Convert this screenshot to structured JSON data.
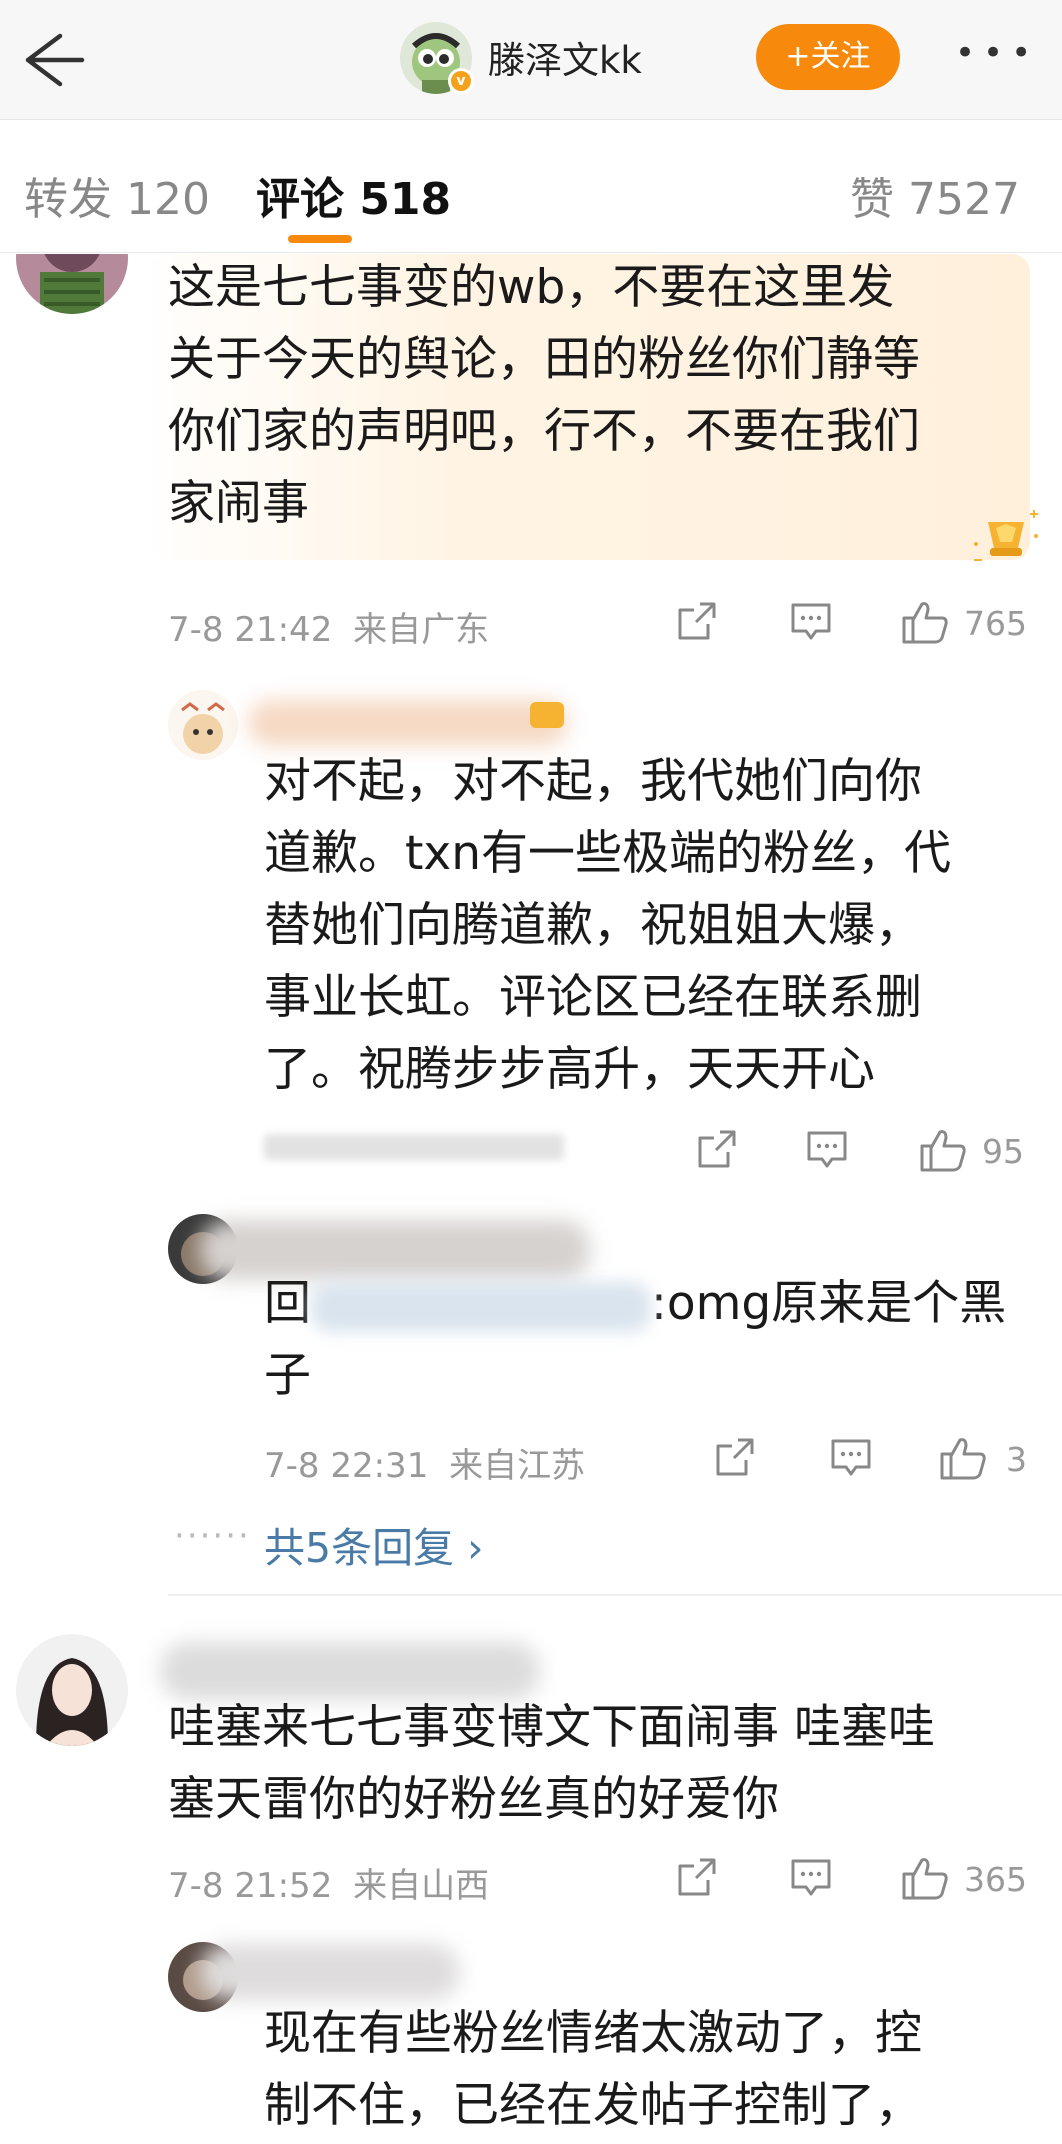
{
  "header": {
    "back_icon": "back-arrow-icon",
    "user_name": "滕泽文kk",
    "follow_label": "+关注",
    "more_label": "•••"
  },
  "tabs": {
    "repost": "转发 120",
    "comment": "评论 518",
    "like": "赞 7527"
  },
  "colors": {
    "accent": "#f78a0d",
    "link": "#4a7ba7",
    "meta": "#999999"
  },
  "comments": [
    {
      "text": "这是七七事变的wb，不要在这里发\n关于今天的舆论，田的粉丝你们静等\n你们家的声明吧，行不，不要在我们\n家闹事",
      "time": "7-8 21:42",
      "location": "来自广东",
      "likes": "765",
      "badge_icon": "trophy-icon"
    },
    {
      "text": "对不起，对不起，我代她们向你\n道歉。txn有一些极端的粉丝，代\n替她们向腾道歉，祝姐姐大爆，\n事业长虹。评论区已经在联系删\n了。祝腾步步高升，天天开心",
      "likes": "95"
    },
    {
      "text_prefix": "回",
      "text_suffix": ":omg原来是个黑\n子",
      "time": "7-8 22:31",
      "location": "来自江苏",
      "likes": "3"
    },
    {
      "more_replies": "共5条回复 ›"
    },
    {
      "text": "哇塞来七七事变博文下面闹事 哇塞哇\n塞天雷你的好粉丝真的好爱你",
      "time": "7-8 21:52",
      "location": "来自山西",
      "likes": "365"
    },
    {
      "text": "现在有些粉丝情绪太激动了，控\n制不住，已经在发帖子控制了，"
    }
  ]
}
